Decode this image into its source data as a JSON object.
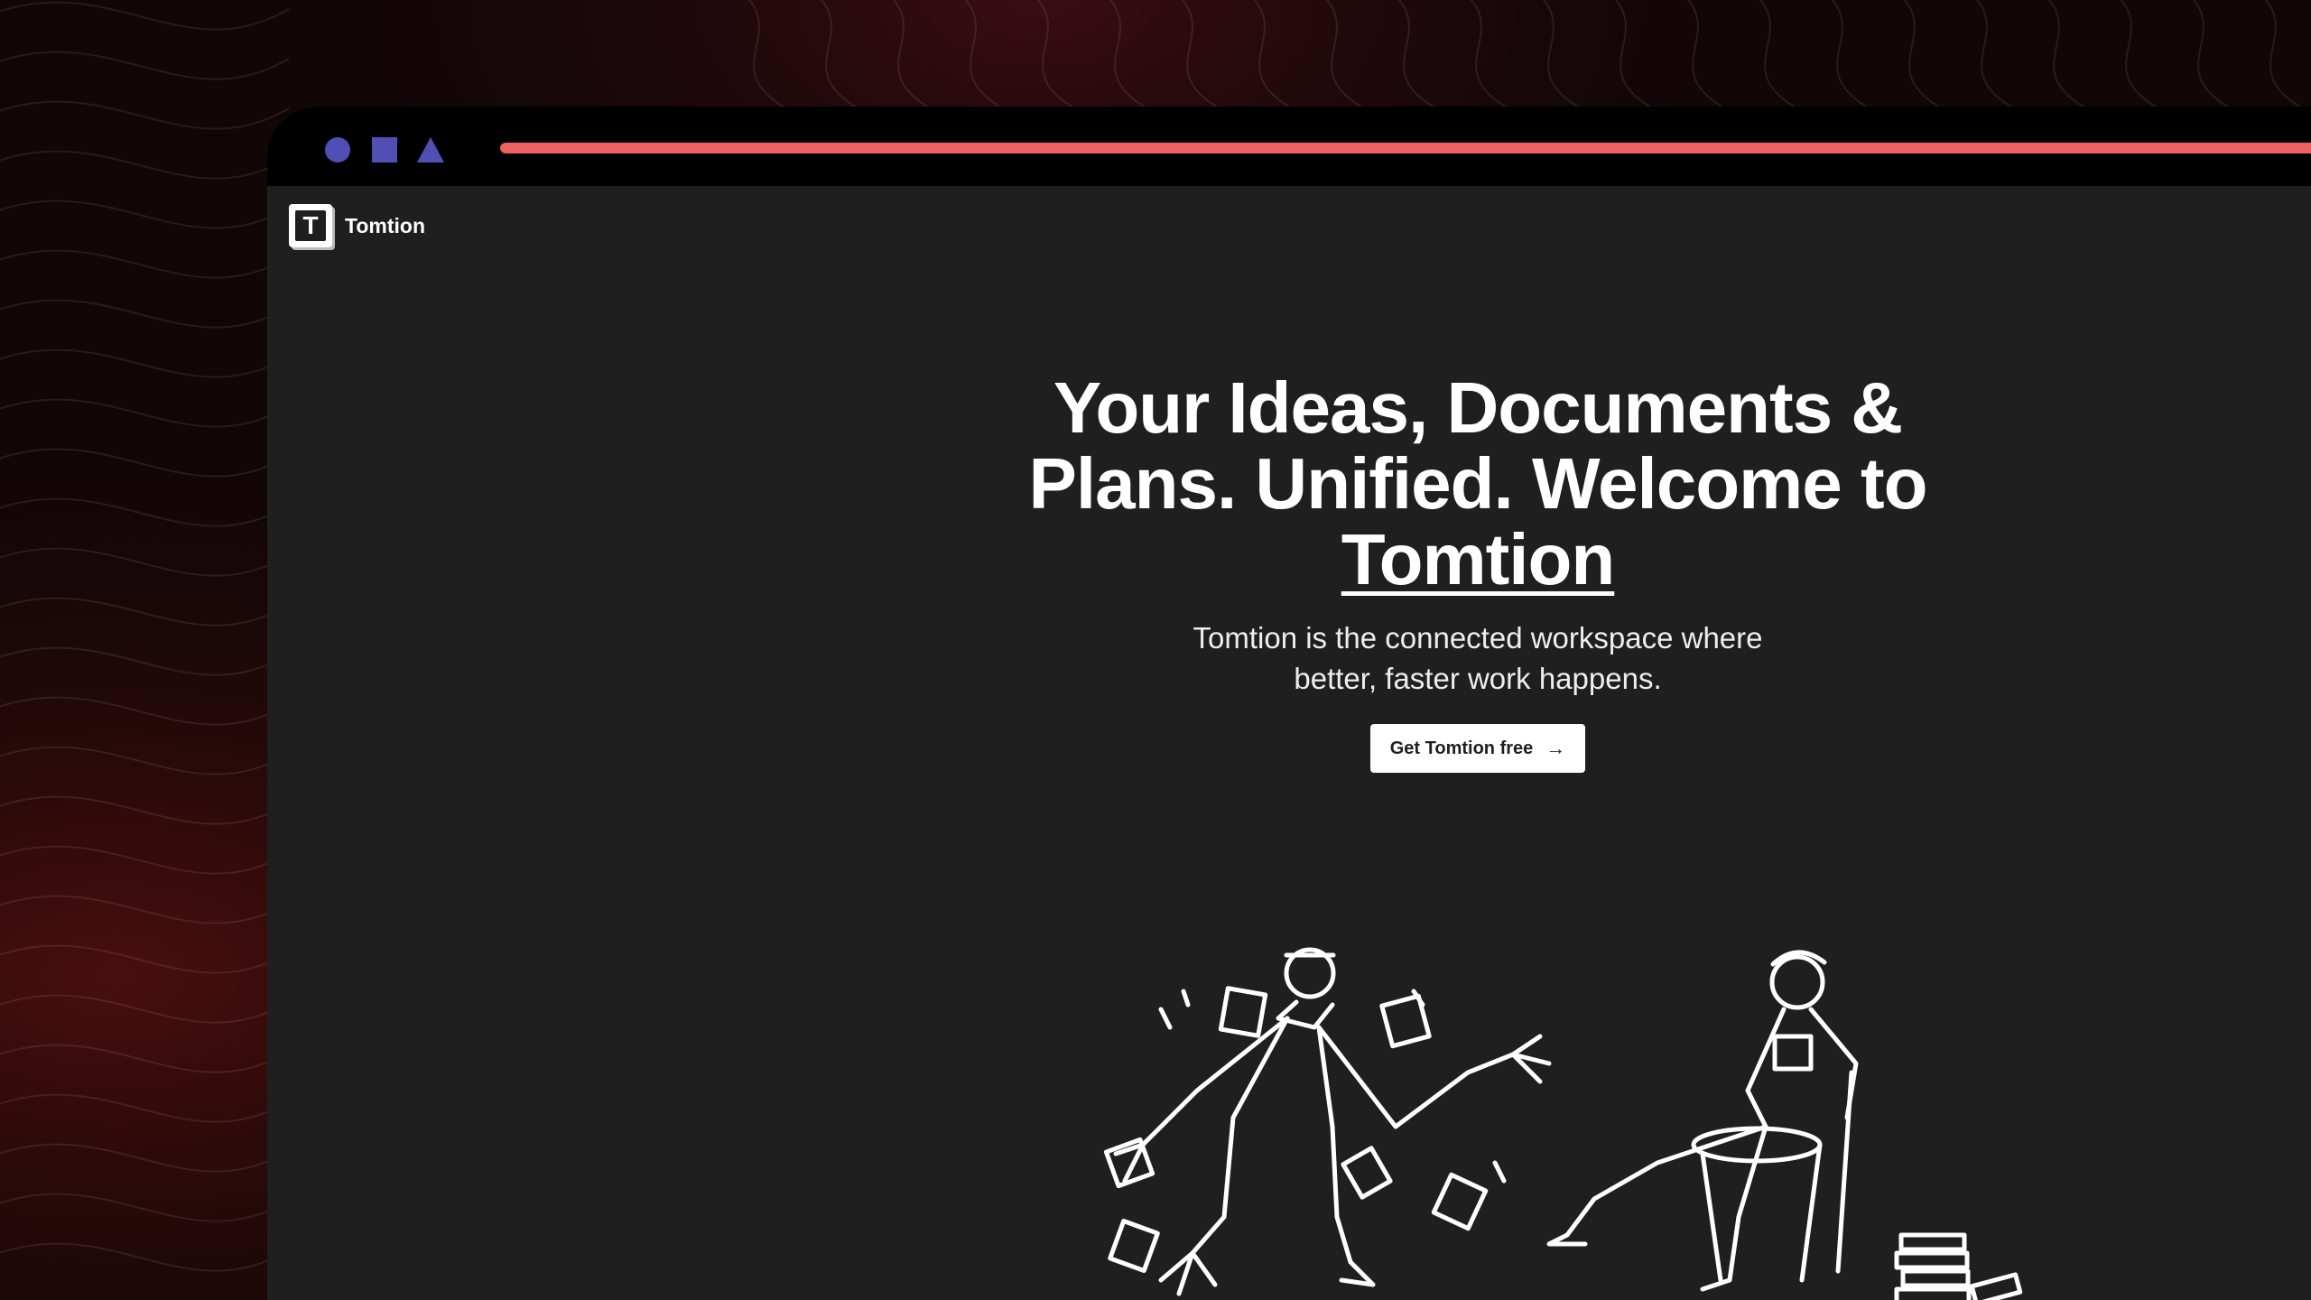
{
  "window_controls": [
    {
      "icon": "circle-icon",
      "color": "#4f4fb5"
    },
    {
      "icon": "square-icon",
      "color": "#4f4fb5"
    },
    {
      "icon": "triangle-icon",
      "color": "#4f4fb5"
    }
  ],
  "progress": {
    "value": 1.0,
    "color": "#ef6262"
  },
  "brand": {
    "logo_letter": "T",
    "name": "Tomtion"
  },
  "hero": {
    "headline_part1": "Your Ideas, Documents & Plans. Unified. Welcome to ",
    "headline_link": "Tomtion",
    "subtitle": "Tomtion is the connected workspace where better, faster work happens.",
    "cta_label": "Get Tomtion free",
    "cta_icon": "arrow-right-icon"
  },
  "colors": {
    "page": "#1f1f1f",
    "chrome": "#000000",
    "text": "#ffffff",
    "accent": "#ef6262"
  }
}
